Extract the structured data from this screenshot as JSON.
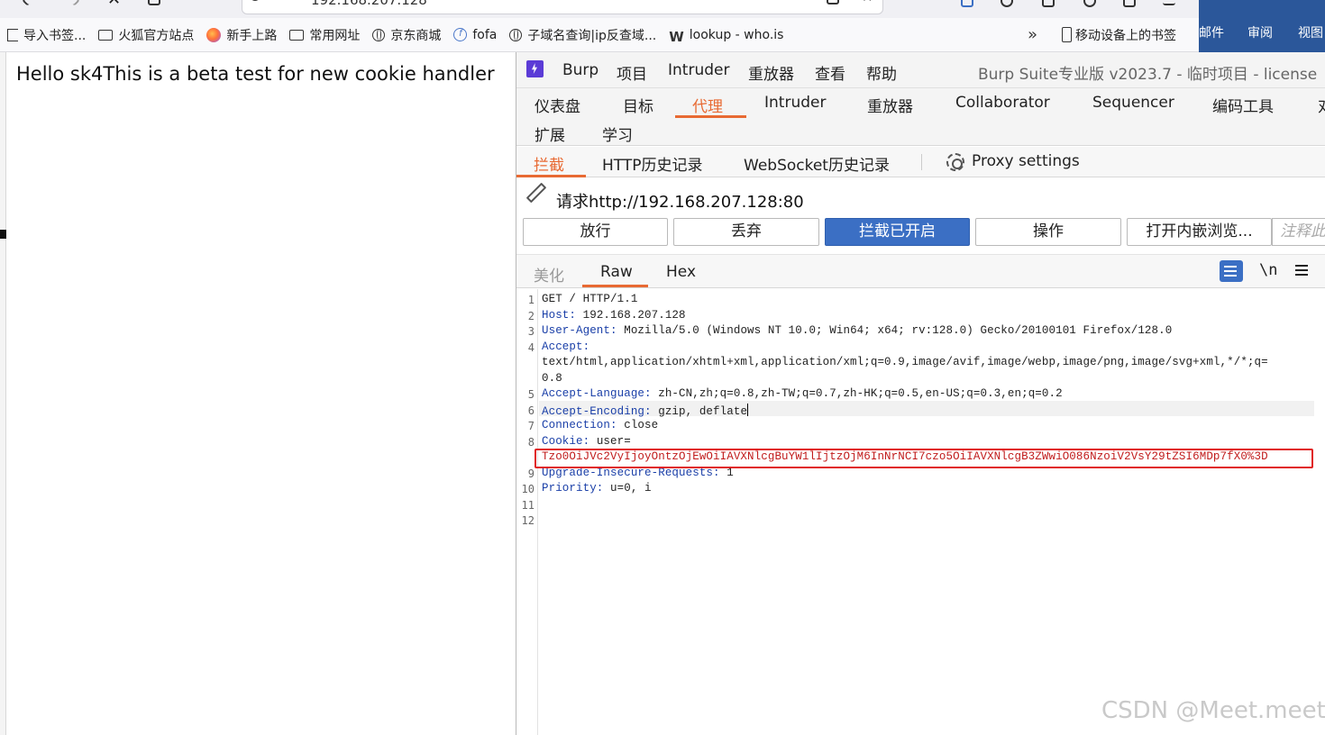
{
  "browser": {
    "url": "192.168.207.128",
    "bookmarks": [
      {
        "label": "导入书签...",
        "icon": "import-icon"
      },
      {
        "label": "火狐官方站点",
        "icon": "folder-icon"
      },
      {
        "label": "新手上路",
        "icon": "firefox-icon"
      },
      {
        "label": "常用网址",
        "icon": "folder-icon"
      },
      {
        "label": "京东商城",
        "icon": "globe-icon"
      },
      {
        "label": "fofa",
        "icon": "fofa-icon"
      },
      {
        "label": "子域名查询|ip反查域...",
        "icon": "globe-icon"
      },
      {
        "label": "lookup - who.is",
        "icon": "w-icon"
      }
    ],
    "more_label": "»",
    "mobile_bookmarks": "移动设备上的书签"
  },
  "background_app": {
    "tabs": [
      "邮件",
      "审阅",
      "视图"
    ],
    "color": "#2b579a"
  },
  "page": {
    "body_text": "Hello sk4This is a beta test for new cookie handler"
  },
  "burp": {
    "menu": [
      "Burp",
      "项目",
      "Intruder",
      "重放器",
      "查看",
      "帮助"
    ],
    "title": "Burp Suite专业版  v2023.7 - 临时项目 - license",
    "main_tabs": [
      "仪表盘",
      "目标",
      "代理",
      "Intruder",
      "重放器",
      "Collaborator",
      "Sequencer",
      "编码工具",
      "对",
      "扩展",
      "学习"
    ],
    "active_main_tab": "代理",
    "proxy_tabs": [
      "拦截",
      "HTTP历史记录",
      "WebSocket历史记录"
    ],
    "proxy_settings": "Proxy settings",
    "request_label": "请求http://192.168.207.128:80",
    "buttons": [
      "放行",
      "丢弃",
      "拦截已开启",
      "操作",
      "打开内嵌浏览..."
    ],
    "note_placeholder": "注释此",
    "view_tabs": [
      "美化",
      "Raw",
      "Hex"
    ],
    "newline_label": "\\n",
    "accent": "#e86a33",
    "primary": "#3b6fc4",
    "request_lines": [
      {
        "n": "1",
        "k": "",
        "v": "GET / HTTP/1.1"
      },
      {
        "n": "2",
        "k": "Host:",
        "v": " 192.168.207.128"
      },
      {
        "n": "3",
        "k": "User-Agent:",
        "v": " Mozilla/5.0 (Windows NT 10.0; Win64; x64; rv:128.0) Gecko/20100101 Firefox/128.0"
      },
      {
        "n": "4",
        "k": "Accept:",
        "v": ""
      },
      {
        "n": "",
        "k": "",
        "v": "text/html,application/xhtml+xml,application/xml;q=0.9,image/avif,image/webp,image/png,image/svg+xml,*/*;q="
      },
      {
        "n": "",
        "k": "",
        "v": "0.8"
      },
      {
        "n": "5",
        "k": "Accept-Language:",
        "v": " zh-CN,zh;q=0.8,zh-TW;q=0.7,zh-HK;q=0.5,en-US;q=0.3,en;q=0.2"
      },
      {
        "n": "6",
        "k": "Accept-Encoding:",
        "v": " gzip, deflate"
      },
      {
        "n": "7",
        "k": "Connection:",
        "v": " close"
      },
      {
        "n": "8",
        "k": "Cookie:",
        "v": " user="
      },
      {
        "n": "",
        "k": "",
        "v": "Tzo0OiJVc2VyIjoyOntzOjEwOiIAVXNlcgBuYW1lIjtzOjM6InNrNCI7czo5OiIAVXNlcgB3ZWwiO086NzoiV2VsY29tZSI6MDp7fX0%3D"
      },
      {
        "n": "9",
        "k": "Upgrade-Insecure-Requests:",
        "v": " 1"
      },
      {
        "n": "10",
        "k": "Priority:",
        "v": " u=0, i"
      },
      {
        "n": "11",
        "k": "",
        "v": ""
      },
      {
        "n": "12",
        "k": "",
        "v": ""
      }
    ]
  },
  "watermark": "CSDN @Meet.meet"
}
